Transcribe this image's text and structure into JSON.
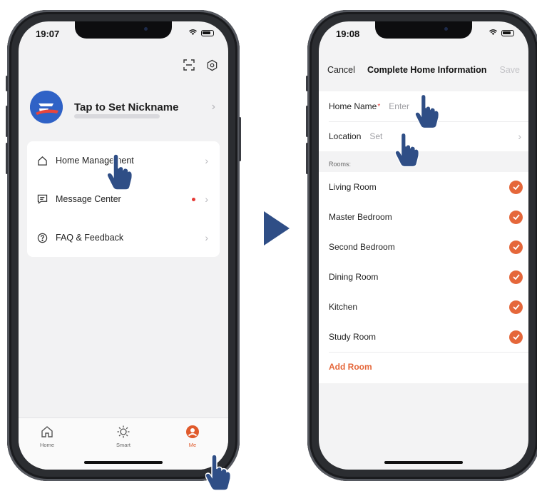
{
  "left_phone": {
    "status_time": "19:07",
    "profile": {
      "nickname_prompt": "Tap to Set Nickname"
    },
    "menu": [
      {
        "label": "Home Management",
        "icon": "house-icon"
      },
      {
        "label": "Message Center",
        "icon": "message-icon",
        "has_unread_dot": true
      },
      {
        "label": "FAQ & Feedback",
        "icon": "question-icon"
      }
    ],
    "tabs": [
      {
        "label": "Home",
        "icon": "home-icon"
      },
      {
        "label": "Smart",
        "icon": "sun-icon"
      },
      {
        "label": "Me",
        "icon": "profile-icon",
        "active": true
      }
    ]
  },
  "right_phone": {
    "status_time": "19:08",
    "nav": {
      "cancel": "Cancel",
      "title": "Complete Home Information",
      "save": "Save"
    },
    "home_name": {
      "label": "Home Name",
      "required_mark": "*",
      "placeholder": "Enter"
    },
    "location": {
      "label": "Location",
      "value": "Set"
    },
    "rooms_header": "Rooms:",
    "rooms": [
      {
        "name": "Living Room",
        "checked": true
      },
      {
        "name": "Master Bedroom",
        "checked": true
      },
      {
        "name": "Second Bedroom",
        "checked": true
      },
      {
        "name": "Dining Room",
        "checked": true
      },
      {
        "name": "Kitchen",
        "checked": true
      },
      {
        "name": "Study Room",
        "checked": true
      }
    ],
    "add_room": "Add Room"
  },
  "colors": {
    "accent": "#e5673a",
    "arrow": "#2f4e86",
    "hand": "#2f4e86",
    "avatar": "#2f62c6"
  }
}
